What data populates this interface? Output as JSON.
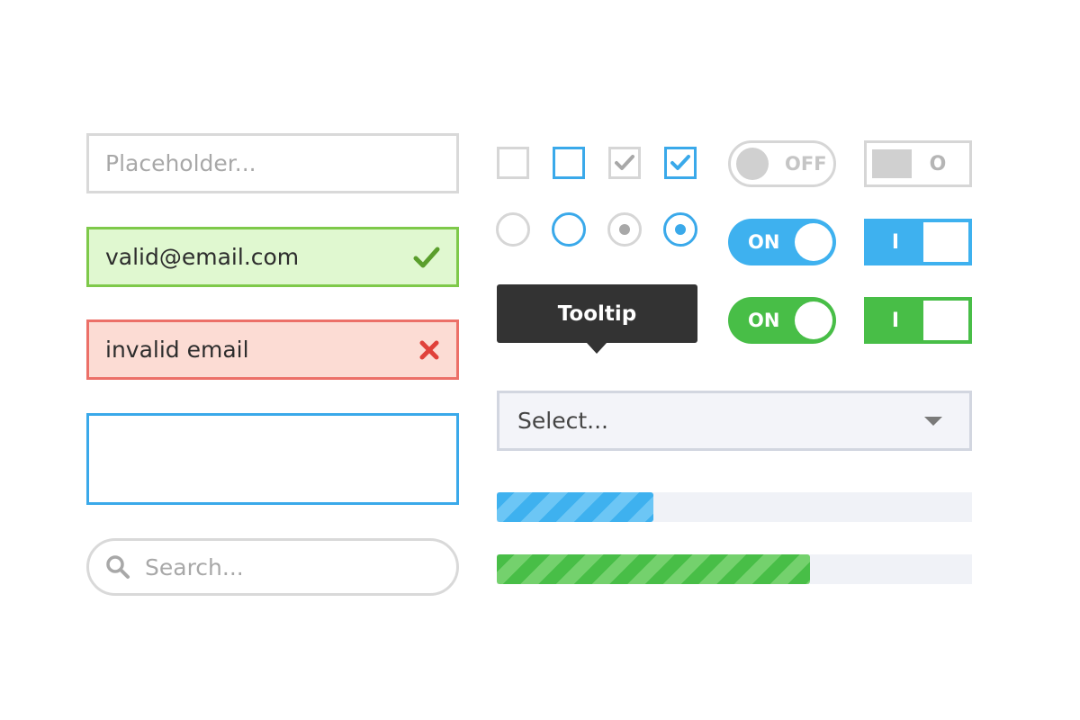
{
  "inputs": {
    "placeholder_field": {
      "placeholder": "Placeholder..."
    },
    "valid_field": {
      "value": "valid@email.com"
    },
    "invalid_field": {
      "value": "invalid email"
    },
    "focused_field": {
      "value": ""
    },
    "search_field": {
      "placeholder": "Search..."
    }
  },
  "checkboxes": [
    {
      "state": "unchecked",
      "color": "grey"
    },
    {
      "state": "unchecked",
      "color": "blue"
    },
    {
      "state": "checked",
      "color": "grey"
    },
    {
      "state": "checked",
      "color": "blue"
    }
  ],
  "radios": [
    {
      "state": "unselected",
      "color": "grey"
    },
    {
      "state": "unselected",
      "color": "blue"
    },
    {
      "state": "selected",
      "color": "grey"
    },
    {
      "state": "selected",
      "color": "blue"
    }
  ],
  "toggles": {
    "round_off": {
      "label": "OFF",
      "state": "off"
    },
    "round_on_blue": {
      "label": "ON",
      "state": "on",
      "color": "#3eb1ef"
    },
    "round_on_green": {
      "label": "ON",
      "state": "on",
      "color": "#48be47"
    },
    "square_off": {
      "label": "O",
      "state": "off"
    },
    "square_on_blue": {
      "label": "I",
      "state": "on",
      "color": "#3eb1ef"
    },
    "square_on_green": {
      "label": "I",
      "state": "on",
      "color": "#48be47"
    }
  },
  "tooltip": {
    "text": "Tooltip"
  },
  "select": {
    "label": "Select..."
  },
  "progress": [
    {
      "color": "#3eb1ef",
      "value": 0.33
    },
    {
      "color": "#48be47",
      "value": 0.66
    }
  ],
  "colors": {
    "accent_blue": "#3aa9ea",
    "valid_green": "#7ec94a",
    "invalid_red": "#ec7068",
    "checkmark_green": "#5a9e2c",
    "cross_red": "#e0413a"
  },
  "icons": [
    "check-icon",
    "cross-icon",
    "search-icon",
    "chevron-down-icon"
  ]
}
